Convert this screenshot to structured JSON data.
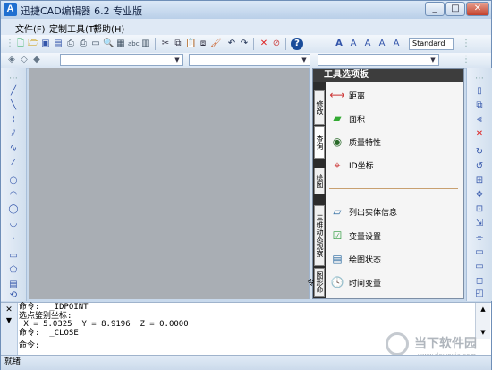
{
  "window": {
    "title": "迅捷CAD编辑器 6.2 专业版",
    "app_icon": "A",
    "minimize": "_",
    "maximize": "□",
    "close": "✕"
  },
  "menu": [
    "文件(F)",
    "定制工具(T)",
    "帮助(H)"
  ],
  "toolbar": {
    "textstyle_value": "Standard"
  },
  "tool_palette": {
    "title": "工具选项板",
    "tabs": [
      "修改",
      "查询",
      "绘图",
      "三维动态观察",
      "图形命令"
    ],
    "tools": [
      {
        "label": "距离",
        "icon": "distance-icon"
      },
      {
        "label": "面积",
        "icon": "area-icon"
      },
      {
        "label": "质量特性",
        "icon": "mass-properties-icon"
      },
      {
        "label": "ID坐标",
        "icon": "id-point-icon"
      },
      {
        "label": "列出实体信息",
        "icon": "list-entity-icon"
      },
      {
        "label": "变量设置",
        "icon": "set-variable-icon"
      },
      {
        "label": "绘图状态",
        "icon": "drawing-status-icon"
      },
      {
        "label": "时间变量",
        "icon": "time-variable-icon"
      }
    ]
  },
  "command": {
    "history": [
      "命令:  _IDPOINT",
      "选点鉴别坐标:",
      " X = 5.0325  Y = 8.9196  Z = 0.0000",
      "命令:  _CLOSE"
    ],
    "prompt": "命令:"
  },
  "status": {
    "text": "就绪"
  },
  "watermark": {
    "text": "当下软件园",
    "sub": "www.downxia.com"
  }
}
